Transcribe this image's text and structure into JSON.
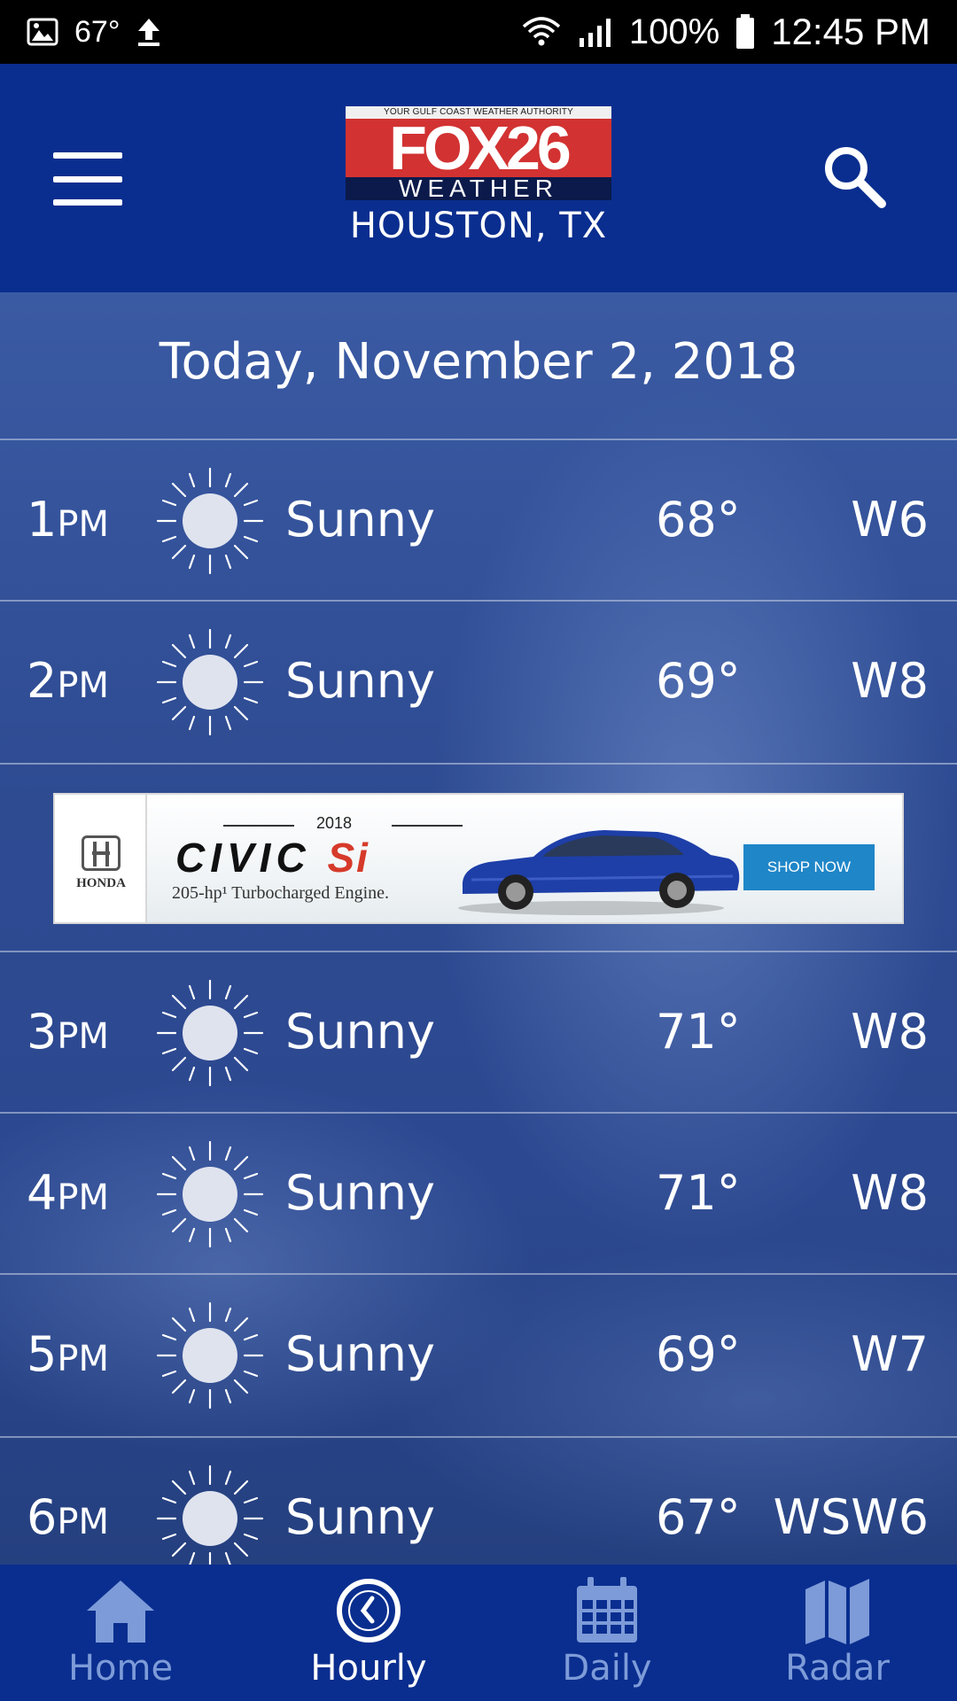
{
  "status_bar": {
    "temperature": "67°",
    "battery": "100%",
    "time": "12:45 PM"
  },
  "header": {
    "logo_tagline": "YOUR GULF COAST WEATHER AUTHORITY",
    "logo_main": "FOX26",
    "logo_sub": "WEATHER",
    "location": "HOUSTON, TX",
    "menu_icon": "hamburger-menu-icon",
    "search_icon": "search-icon"
  },
  "main": {
    "date": "Today, November 2, 2018",
    "hours": [
      {
        "hour": "1",
        "ampm": "PM",
        "condition": "Sunny",
        "temp": "68°",
        "wind": "W6",
        "icon": "sun-icon"
      },
      {
        "hour": "2",
        "ampm": "PM",
        "condition": "Sunny",
        "temp": "69°",
        "wind": "W8",
        "icon": "sun-icon"
      },
      {
        "hour": "3",
        "ampm": "PM",
        "condition": "Sunny",
        "temp": "71°",
        "wind": "W8",
        "icon": "sun-icon"
      },
      {
        "hour": "4",
        "ampm": "PM",
        "condition": "Sunny",
        "temp": "71°",
        "wind": "W8",
        "icon": "sun-icon"
      },
      {
        "hour": "5",
        "ampm": "PM",
        "condition": "Sunny",
        "temp": "69°",
        "wind": "W7",
        "icon": "sun-icon"
      },
      {
        "hour": "6",
        "ampm": "PM",
        "condition": "Sunny",
        "temp": "67°",
        "wind": "WSW6",
        "icon": "sun-icon"
      }
    ]
  },
  "ad": {
    "brand": "HONDA",
    "year": "2018",
    "title_main": "CIVIC",
    "title_accent": "Si",
    "tagline": "205-hp¹ Turbocharged Engine.",
    "cta": "SHOP NOW"
  },
  "bottom_nav": {
    "items": [
      {
        "label": "Home",
        "icon": "home-icon",
        "active": false
      },
      {
        "label": "Hourly",
        "icon": "clock-icon",
        "active": true
      },
      {
        "label": "Daily",
        "icon": "calendar-icon",
        "active": false
      },
      {
        "label": "Radar",
        "icon": "map-icon",
        "active": false
      }
    ]
  },
  "colors": {
    "header_bg": "#0a2e8f",
    "nav_inactive": "#7d9bd8",
    "nav_active": "#ffffff",
    "logo_red": "#d23232"
  }
}
